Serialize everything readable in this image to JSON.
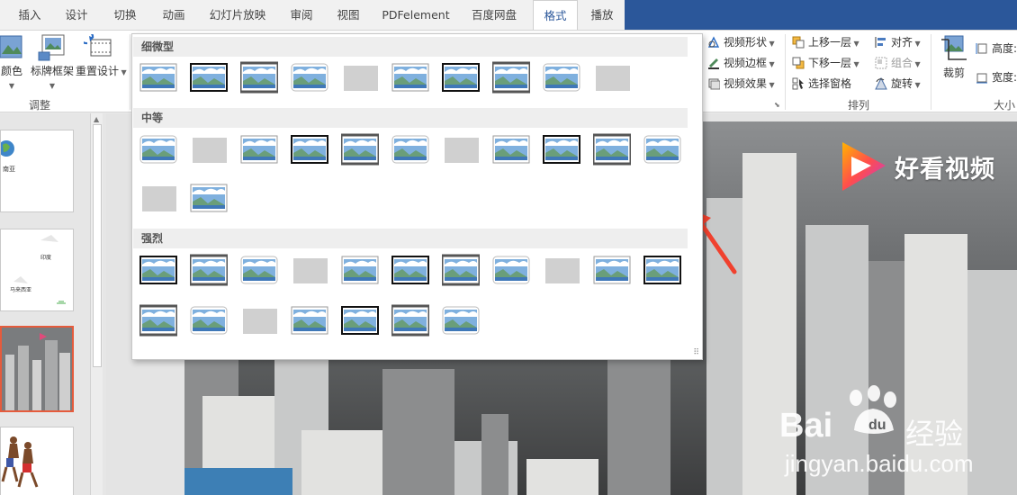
{
  "tabs": [
    {
      "label": "插入",
      "active": false
    },
    {
      "label": "设计",
      "active": false
    },
    {
      "label": "切换",
      "active": false
    },
    {
      "label": "动画",
      "active": false
    },
    {
      "label": "幻灯片放映",
      "active": false
    },
    {
      "label": "审阅",
      "active": false
    },
    {
      "label": "视图",
      "active": false
    },
    {
      "label": "PDFelement",
      "active": false
    },
    {
      "label": "百度网盘",
      "active": false
    },
    {
      "label": "格式",
      "active": true
    },
    {
      "label": "播放",
      "active": false
    }
  ],
  "ribbon": {
    "adjust": {
      "color_label": "颜色",
      "poster_frame_label": "标牌框架",
      "reset_design_label": "重置设计",
      "group_label": "调整"
    },
    "video_styles": {
      "shape_label": "视频形状",
      "border_label": "视频边框",
      "effects_label": "视频效果"
    },
    "arrange": {
      "bring_forward_label": "上移一层",
      "send_backward_label": "下移一层",
      "selection_pane_label": "选择窗格",
      "align_label": "对齐",
      "group_label_btn": "组合",
      "rotate_label": "旋转",
      "group_label": "排列"
    },
    "size": {
      "crop_label": "裁剪",
      "height_label": "高度:",
      "width_label": "宽度:",
      "group_label": "大小"
    }
  },
  "thumbnails": [
    {
      "caption": "南亚"
    },
    {
      "caption": "印度",
      "caption2": "马来西亚"
    },
    {
      "caption": ""
    },
    {
      "caption": ""
    }
  ],
  "gallery": {
    "sections": [
      {
        "title": "细微型",
        "count": 10
      },
      {
        "title": "中等",
        "count": 13
      },
      {
        "title": "强烈",
        "count": 18
      }
    ]
  },
  "watermarks": {
    "haokan": "好看视频",
    "baidu": "Bai",
    "baidu_suffix": "经验",
    "url": "jingyan.baidu.com"
  },
  "colors": {
    "accent": "#2b579a",
    "selected_thumb": "#e55b3c",
    "arrow": "#f0412e"
  }
}
